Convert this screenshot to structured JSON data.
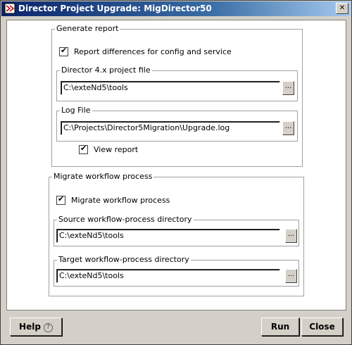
{
  "window": {
    "title": "Director Project Upgrade: MigDirector50",
    "close_glyph": "✕"
  },
  "generate": {
    "legend": "Generate report",
    "report_diff_label": "Report differences for config and service",
    "report_diff_checked": true,
    "project_file_legend": "Director 4.x project file",
    "project_file_value": "C:\\exteNd5\\tools",
    "log_file_legend": "Log File",
    "log_file_value": "C:\\Projects\\Director5Migration\\Upgrade.log",
    "view_report_label": "View report",
    "view_report_checked": true
  },
  "migrate": {
    "legend": "Migrate workflow process",
    "migrate_label": "Migrate workflow process",
    "migrate_checked": true,
    "source_legend": "Source workflow-process directory",
    "source_value": "C:\\exteNd5\\tools",
    "target_legend": "Target workflow-process directory",
    "target_value": "C:\\exteNd5\\tools"
  },
  "browse_label": "...",
  "buttons": {
    "help": "Help",
    "help_icon": "?",
    "run": "Run",
    "close": "Close"
  }
}
